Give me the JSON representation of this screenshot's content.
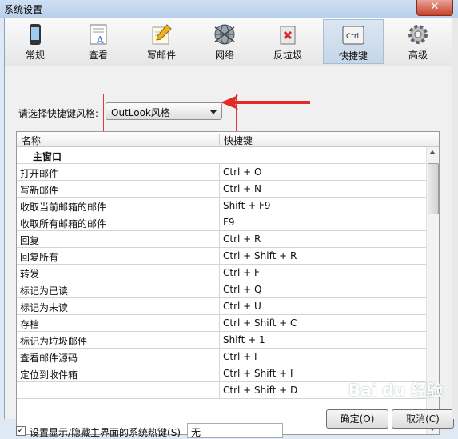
{
  "window": {
    "title": "系统设置",
    "close_label": "✕"
  },
  "toolbar": {
    "tabs": [
      {
        "label": "常规",
        "icon": "phone-icon"
      },
      {
        "label": "查看",
        "icon": "document-view-icon"
      },
      {
        "label": "写邮件",
        "icon": "pencil-notepad-icon"
      },
      {
        "label": "网络",
        "icon": "globe-icon"
      },
      {
        "label": "反垃圾",
        "icon": "trash-block-icon"
      },
      {
        "label": "快捷键",
        "icon": "ctrl-key-icon",
        "active": true,
        "key_text": "Ctrl"
      },
      {
        "label": "高级",
        "icon": "gear-icon"
      }
    ]
  },
  "scheme": {
    "label": "请选择快捷键风格:",
    "value": "OutLook风格"
  },
  "table": {
    "headers": {
      "name": "名称",
      "key": "快捷键"
    },
    "group": "主窗口",
    "rows": [
      {
        "name": "打开邮件",
        "key": "Ctrl + O"
      },
      {
        "name": "写新邮件",
        "key": "Ctrl + N"
      },
      {
        "name": "收取当前邮箱的邮件",
        "key": "Shift + F9"
      },
      {
        "name": "收取所有邮箱的邮件",
        "key": "F9"
      },
      {
        "name": "回复",
        "key": "Ctrl + R"
      },
      {
        "name": "回复所有",
        "key": "Ctrl + Shift + R"
      },
      {
        "name": "转发",
        "key": "Ctrl + F"
      },
      {
        "name": "标记为已读",
        "key": "Ctrl + Q"
      },
      {
        "name": "标记为未读",
        "key": "Ctrl + U"
      },
      {
        "name": "存档",
        "key": "Ctrl + Shift + C"
      },
      {
        "name": "标记为垃圾邮件",
        "key": "Shift + 1"
      },
      {
        "name": "查看邮件源码",
        "key": "Ctrl + I"
      },
      {
        "name": "定位到收件箱",
        "key": "Ctrl + Shift + I"
      },
      {
        "name": "",
        "key": "Ctrl + Shift + D"
      }
    ]
  },
  "hotkey": {
    "label": "设置显示/隐藏主界面的系统热键(S)",
    "checked": true,
    "check_mark": "✓",
    "value": "无"
  },
  "buttons": {
    "ok": "确定(O)",
    "cancel": "取消(C)"
  },
  "watermark": "Bai du 经验"
}
